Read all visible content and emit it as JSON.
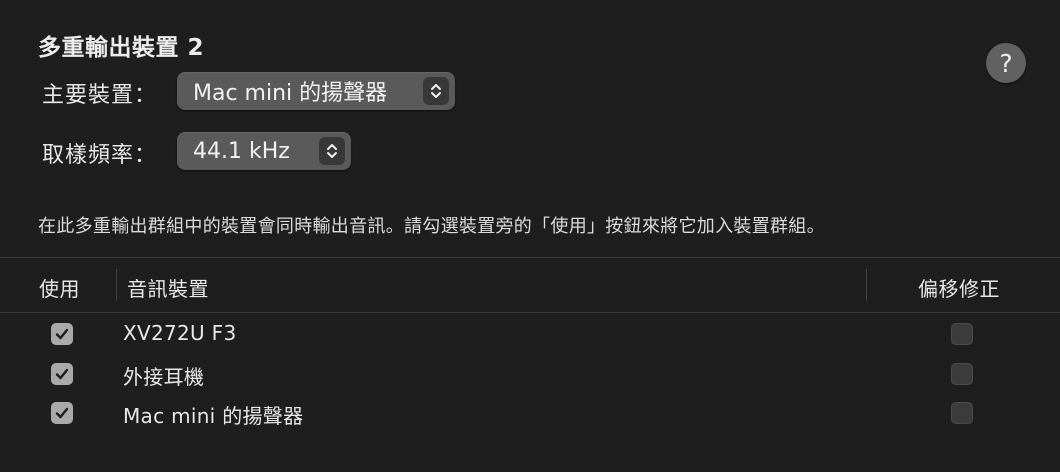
{
  "title": "多重輸出裝置 2",
  "help_button": {
    "label": "?"
  },
  "master_device": {
    "label": "主要裝置：",
    "value": "Mac mini 的揚聲器"
  },
  "sample_rate": {
    "label": "取樣頻率：",
    "value": "44.1 kHz"
  },
  "description": "在此多重輸出群組中的裝置會同時輸出音訊。請勾選裝置旁的「使用」按鈕來將它加入裝置群組。",
  "table": {
    "headers": {
      "use": "使用",
      "device": "音訊裝置",
      "drift": "偏移修正"
    },
    "rows": [
      {
        "use": true,
        "name": "XV272U F3",
        "drift": false
      },
      {
        "use": true,
        "name": "外接耳機",
        "drift": false
      },
      {
        "use": true,
        "name": "Mac mini 的揚聲器",
        "drift": false
      }
    ]
  }
}
